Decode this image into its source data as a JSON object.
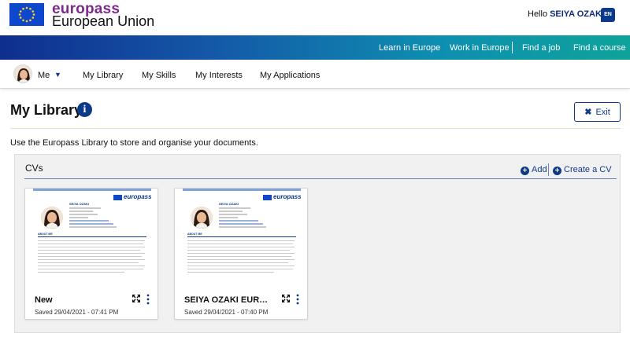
{
  "brand": {
    "europass": "europass",
    "european_union": "European Union"
  },
  "user": {
    "hello": "Hello",
    "name": "SEIYA OZAKI",
    "language": "EN"
  },
  "topnav": {
    "items": [
      "Learn in Europe",
      "Work in Europe",
      "Find a job",
      "Find a course"
    ]
  },
  "subnav": {
    "me": "Me",
    "items": [
      "My Library",
      "My Skills",
      "My Interests",
      "My Applications"
    ]
  },
  "page": {
    "title": "My Library",
    "exit_label": "Exit",
    "intro": "Use the Europass Library to store and organise your documents."
  },
  "cvs": {
    "title": "CVs",
    "add_label": "Add",
    "create_label": "Create a CV",
    "cards": [
      {
        "name": "New",
        "saved": "Saved 29/04/2021 - 07:41 PM"
      },
      {
        "name": "SEIYA OZAKI EURO...",
        "saved": "Saved 29/04/2021 - 07:40 PM"
      }
    ]
  },
  "thumb": {
    "logo": "europass",
    "name": "SEIYA OZAKI",
    "about": "ABOUT ME"
  },
  "colors": {
    "brand_purple": "#7d2b8a",
    "accent_blue": "#0c3a8a",
    "eu_blue": "#0e47cb"
  },
  "icons": [
    "eu-flag-icon",
    "info-icon",
    "close-icon",
    "plus-circle-icon",
    "expand-icon",
    "more-vertical-icon",
    "chevron-down-icon",
    "globe-language-icon"
  ]
}
